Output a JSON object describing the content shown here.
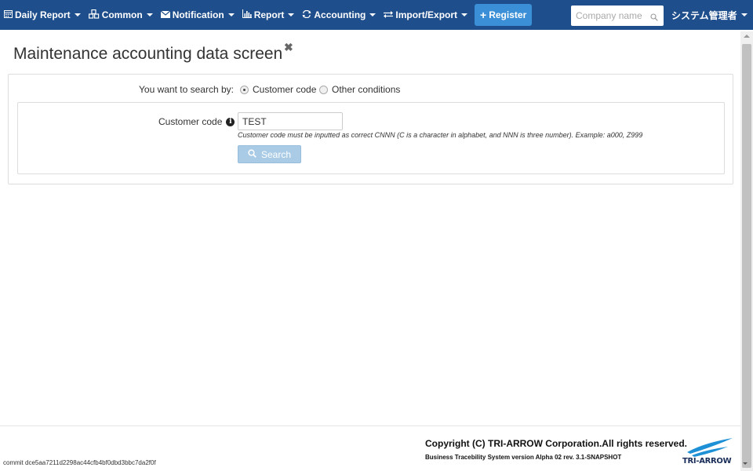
{
  "navbar": {
    "items": [
      {
        "label": "Daily Report",
        "icon": "calendar-icon"
      },
      {
        "label": "Common",
        "icon": "cubes-icon"
      },
      {
        "label": "Notification",
        "icon": "envelope-icon"
      },
      {
        "label": "Report",
        "icon": "bar-chart-icon"
      },
      {
        "label": "Accounting",
        "icon": "exchange-icon"
      },
      {
        "label": "Import/Export",
        "icon": "arrows-icon"
      }
    ],
    "register_label": "Register",
    "company_placeholder": "Company name",
    "user_label": "システム管理者",
    "background_color": "#1f4e8c"
  },
  "page": {
    "title": "Maintenance accounting data screen"
  },
  "search": {
    "by_label": "You want to search by:",
    "options": [
      "Customer code",
      "Other conditions"
    ],
    "selected": "Customer code",
    "customer_code_label": "Customer code",
    "customer_code_value": "TEST",
    "help_text": "Customer code must be inputted as correct CNNN (C is a character in alphabet, and NNN is three number). Example: a000, Z999",
    "button_label": "Search"
  },
  "footer": {
    "copyright": "Copyright (C) TRI-ARROW Corporation.All rights reserved.",
    "version": "Business Tracebility System version Alpha 02 rev. 3.1-SNAPSHOT",
    "commit": "commit dce5aa7211d2298ac44cfb4bf0dbd3bbc7da2f0f",
    "logo_text": "TRI-ARROW"
  }
}
